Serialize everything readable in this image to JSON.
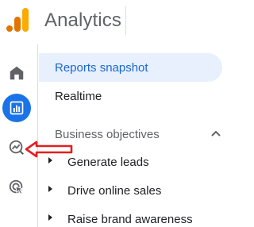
{
  "app": {
    "title": "Analytics",
    "logo_icon": "google-analytics-logo",
    "brand_colors": {
      "logo_dark": "#e37400",
      "logo_light": "#f9ab00"
    }
  },
  "rail": {
    "items": [
      {
        "icon": "home-icon",
        "active": false
      },
      {
        "icon": "reports-icon",
        "active": true
      },
      {
        "icon": "explore-icon",
        "active": false
      },
      {
        "icon": "advertising-icon",
        "active": false
      }
    ],
    "active_color": "#1a73e8"
  },
  "nav": {
    "items": [
      {
        "label": "Reports snapshot",
        "selected": true
      },
      {
        "label": "Realtime",
        "selected": false
      }
    ],
    "section": {
      "label": "Business objectives",
      "expanded": true,
      "chevron_icon": "chevron-up-icon",
      "children": [
        {
          "label": "Generate leads"
        },
        {
          "label": "Drive online sales"
        },
        {
          "label": "Raise brand awareness"
        }
      ]
    }
  },
  "annotation": {
    "arrow_color": "#e02020",
    "arrow_icon": "red-arrow-annotation"
  }
}
